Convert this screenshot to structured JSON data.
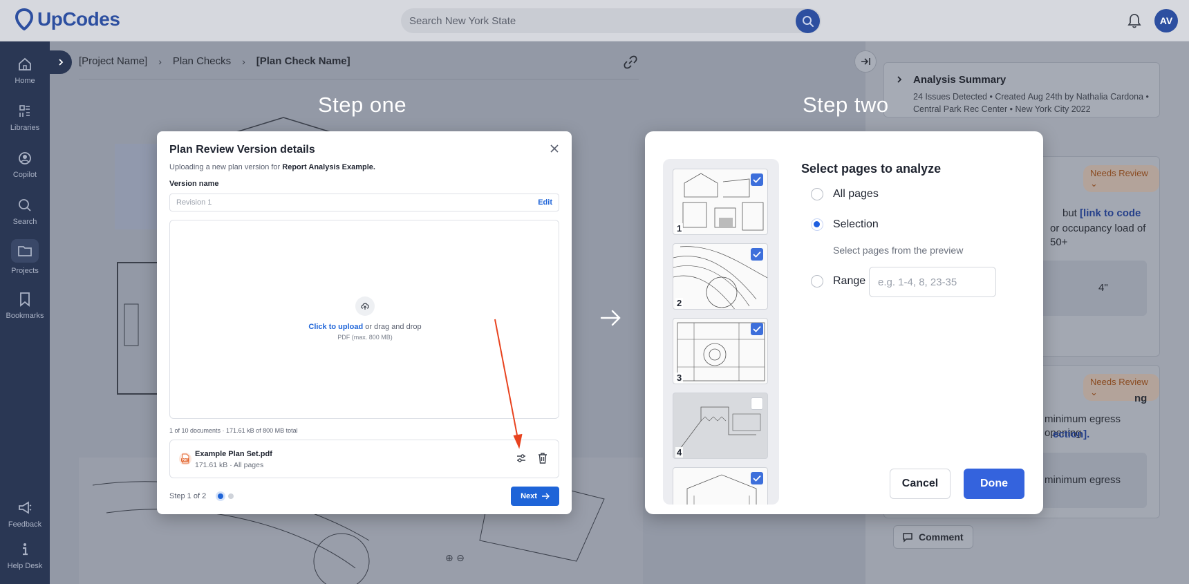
{
  "app": {
    "brand": "UpCodes",
    "search_placeholder": "Search New York State",
    "user_initials": "AV",
    "accent": "#2d4fa0"
  },
  "sidebar": {
    "items": [
      {
        "label": "Home",
        "icon": "home-icon"
      },
      {
        "label": "Libraries",
        "icon": "libraries-icon"
      },
      {
        "label": "Copilot",
        "icon": "copilot-icon"
      },
      {
        "label": "Search",
        "icon": "search-icon"
      },
      {
        "label": "Projects",
        "icon": "folder-icon",
        "active": true
      },
      {
        "label": "Bookmarks",
        "icon": "bookmark-icon"
      },
      {
        "label": "Feedback",
        "icon": "megaphone-icon"
      },
      {
        "label": "Help Desk",
        "icon": "info-icon"
      }
    ]
  },
  "breadcrumb": {
    "items": [
      "[Project Name]",
      "Plan Checks",
      "[Plan Check Name]"
    ]
  },
  "steps": {
    "one": "Step one",
    "two": "Step two"
  },
  "right_panel": {
    "summary_title": "Analysis Summary",
    "summary_meta": "24 Issues Detected • Created Aug 24th by Nathalia Cardona • Central Park Rec Center • New York City 2022",
    "status_label": "Needs Review",
    "issue1_text_a": "but",
    "issue1_link": "[link to code",
    "issue1_text_b": "or occupancy load of 50+",
    "issue1_box_text": "4\"",
    "issue2_heading": "ng",
    "issue2_text": "minimum egress opening",
    "issue2_link": "ection].",
    "issue2_box_text": "minimum egress",
    "comment_label": "Comment"
  },
  "modal1": {
    "title": "Plan Review Version details",
    "subtitle_prefix": "Uploading a new plan version for",
    "subtitle_project": "Report Analysis Example.",
    "version_label": "Version name",
    "version_placeholder": "Revision 1",
    "edit_label": "Edit",
    "upload_link": "Click to upload",
    "upload_rest": "or drag and drop",
    "upload_hint": "PDF (max. 800 MB)",
    "doc_count": "1 of 10 documents · 171.61 kB of 800 MB total",
    "file": {
      "name": "Example Plan Set.pdf",
      "meta": "171.61 kB · All pages"
    },
    "step_text": "Step 1 of 2",
    "next_label": "Next",
    "primary": "#1e64d8"
  },
  "modal2": {
    "title": "Select pages to analyze",
    "options": {
      "all": "All pages",
      "selection": "Selection",
      "selection_sub": "Select pages from the preview",
      "range": "Range"
    },
    "selected": "selection",
    "range_placeholder": "e.g. 1-4, 8, 23-35",
    "pages": [
      {
        "num": "1",
        "checked": true
      },
      {
        "num": "2",
        "checked": true
      },
      {
        "num": "3",
        "checked": true
      },
      {
        "num": "4",
        "checked": false
      },
      {
        "num": "",
        "checked": true
      }
    ],
    "cancel_label": "Cancel",
    "done_label": "Done",
    "primary": "#3463dd"
  }
}
